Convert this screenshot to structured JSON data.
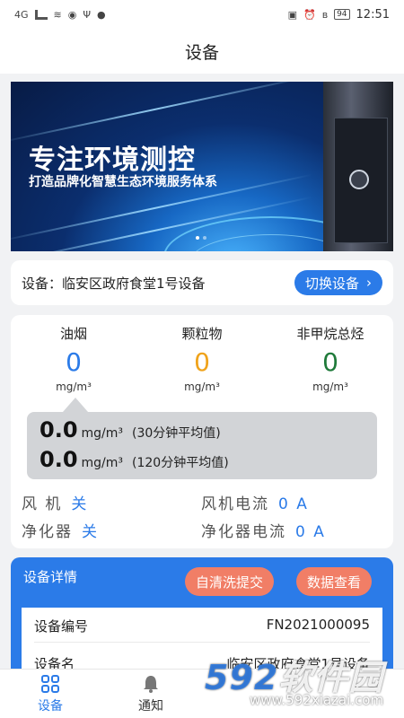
{
  "status_bar": {
    "left_text": "4G",
    "battery": "94",
    "time": "12:51"
  },
  "header": {
    "title": "设备"
  },
  "banner": {
    "title": "专注环境测控",
    "subtitle": "打造品牌化智慧生态环境服务体系"
  },
  "device": {
    "name": "设备：临安区政府食堂1号设备",
    "switch_label": "切换设备"
  },
  "metrics": [
    {
      "label": "油烟",
      "value": "0",
      "unit": "mg/m³",
      "color": "#2b7be8"
    },
    {
      "label": "颗粒物",
      "value": "0",
      "unit": "mg/m³",
      "color": "#f0a31b"
    },
    {
      "label": "非甲烷总烃",
      "value": "0",
      "unit": "mg/m³",
      "color": "#1f7a3a"
    }
  ],
  "averages": [
    {
      "value": "0.0",
      "unit": "mg/m³",
      "note": "(30分钟平均值)"
    },
    {
      "value": "0.0",
      "unit": "mg/m³",
      "note": "(120分钟平均值)"
    }
  ],
  "status": {
    "fan_label": "风 机",
    "fan_value": "关",
    "fan_current_label": "风机电流",
    "fan_current_value": "0 A",
    "purifier_label": "净化器",
    "purifier_value": "关",
    "purifier_current_label": "净化器电流",
    "purifier_current_value": "0 A"
  },
  "detail": {
    "title": "设备详情",
    "self_clean_label": "自清洗提交",
    "data_view_label": "数据查看",
    "rows": [
      {
        "label": "设备编号",
        "value": "FN2021000095"
      },
      {
        "label": "设备名",
        "value": "临安区政府食堂1号设备"
      }
    ]
  },
  "tabs": [
    {
      "label": "设备",
      "icon": "grid-icon",
      "active": true
    },
    {
      "label": "通知",
      "icon": "bell-icon",
      "active": false
    }
  ],
  "watermark": {
    "brand_num": "592",
    "brand_text": "软件园",
    "url": "www.592xiazai.com"
  },
  "colors": {
    "accent": "#2b7be8",
    "orange": "#f17e66"
  }
}
